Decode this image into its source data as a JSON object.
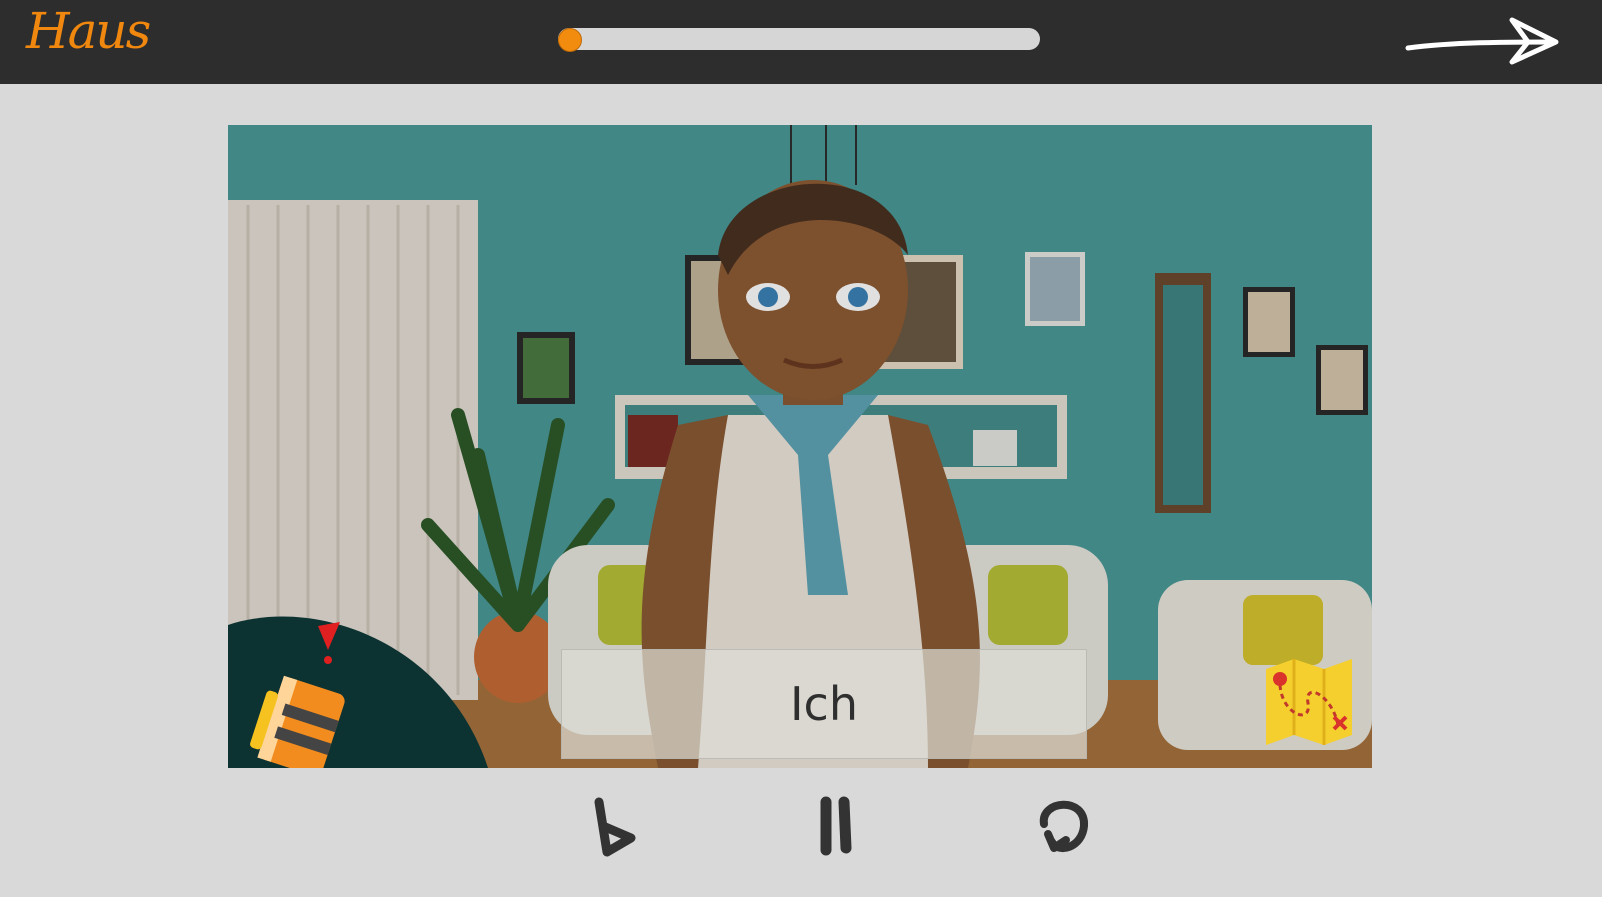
{
  "app": {
    "logo_text": "Haus"
  },
  "progress": {
    "value_percent": 0
  },
  "header": {
    "next_icon": "arrow-right-icon"
  },
  "lesson": {
    "caption": "Ich",
    "scene": "living-room-avatar"
  },
  "overlays": {
    "notebook_icon": "notebook-alert-icon",
    "map_icon": "treasure-map-icon"
  },
  "controls": {
    "play_icon": "play-icon",
    "pause_icon": "pause-icon",
    "replay_icon": "replay-icon"
  },
  "colors": {
    "accent": "#f28c0f",
    "topbar": "#2d2d2d",
    "background": "#d9d9d9",
    "wall": "#4a9a98"
  }
}
